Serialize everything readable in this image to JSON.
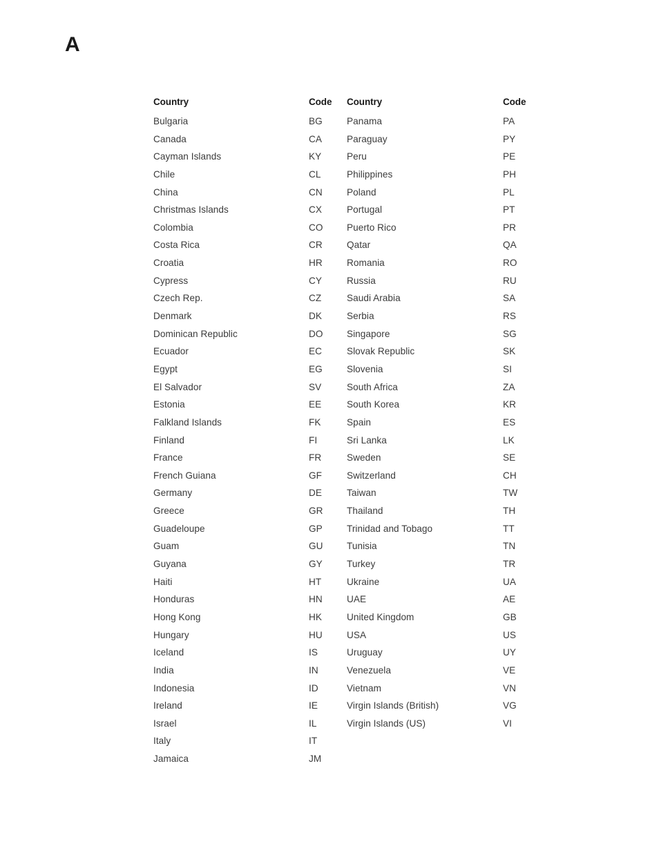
{
  "page": {
    "appendix_letter": "A",
    "background_color": "#ffffff",
    "text_color": "#3b3b3b",
    "heading_color": "#1a1a1a"
  },
  "table": {
    "headers": {
      "country": "Country",
      "code": "Code"
    },
    "left_column": [
      {
        "country": "Bulgaria",
        "code": "BG"
      },
      {
        "country": "Canada",
        "code": "CA"
      },
      {
        "country": "Cayman Islands",
        "code": "KY"
      },
      {
        "country": "Chile",
        "code": "CL"
      },
      {
        "country": "China",
        "code": "CN"
      },
      {
        "country": "Christmas Islands",
        "code": "CX"
      },
      {
        "country": "Colombia",
        "code": "CO"
      },
      {
        "country": "Costa Rica",
        "code": "CR"
      },
      {
        "country": "Croatia",
        "code": "HR"
      },
      {
        "country": "Cypress",
        "code": "CY"
      },
      {
        "country": "Czech Rep.",
        "code": "CZ"
      },
      {
        "country": "Denmark",
        "code": "DK"
      },
      {
        "country": "Dominican Republic",
        "code": "DO"
      },
      {
        "country": "Ecuador",
        "code": "EC"
      },
      {
        "country": "Egypt",
        "code": "EG"
      },
      {
        "country": "El Salvador",
        "code": "SV"
      },
      {
        "country": "Estonia",
        "code": "EE"
      },
      {
        "country": "Falkland Islands",
        "code": "FK"
      },
      {
        "country": "Finland",
        "code": "FI"
      },
      {
        "country": "France",
        "code": "FR"
      },
      {
        "country": "French Guiana",
        "code": "GF"
      },
      {
        "country": "Germany",
        "code": "DE"
      },
      {
        "country": "Greece",
        "code": "GR"
      },
      {
        "country": "Guadeloupe",
        "code": "GP"
      },
      {
        "country": "Guam",
        "code": "GU"
      },
      {
        "country": "Guyana",
        "code": "GY"
      },
      {
        "country": "Haiti",
        "code": "HT"
      },
      {
        "country": "Honduras",
        "code": "HN"
      },
      {
        "country": "Hong Kong",
        "code": "HK"
      },
      {
        "country": "Hungary",
        "code": "HU"
      },
      {
        "country": "Iceland",
        "code": "IS"
      },
      {
        "country": "India",
        "code": "IN"
      },
      {
        "country": "Indonesia",
        "code": "ID"
      },
      {
        "country": "Ireland",
        "code": "IE"
      },
      {
        "country": "Israel",
        "code": "IL"
      },
      {
        "country": "Italy",
        "code": "IT"
      },
      {
        "country": "Jamaica",
        "code": "JM"
      }
    ],
    "right_column": [
      {
        "country": "Panama",
        "code": "PA"
      },
      {
        "country": "Paraguay",
        "code": "PY"
      },
      {
        "country": "Peru",
        "code": "PE"
      },
      {
        "country": "Philippines",
        "code": "PH"
      },
      {
        "country": "Poland",
        "code": "PL"
      },
      {
        "country": "Portugal",
        "code": "PT"
      },
      {
        "country": "Puerto Rico",
        "code": "PR"
      },
      {
        "country": "Qatar",
        "code": "QA"
      },
      {
        "country": "Romania",
        "code": "RO"
      },
      {
        "country": "Russia",
        "code": "RU"
      },
      {
        "country": "Saudi Arabia",
        "code": "SA"
      },
      {
        "country": "Serbia",
        "code": "RS"
      },
      {
        "country": "Singapore",
        "code": "SG"
      },
      {
        "country": "Slovak Republic",
        "code": "SK"
      },
      {
        "country": "Slovenia",
        "code": "SI"
      },
      {
        "country": "South Africa",
        "code": "ZA"
      },
      {
        "country": "South Korea",
        "code": "KR"
      },
      {
        "country": "Spain",
        "code": "ES"
      },
      {
        "country": "Sri Lanka",
        "code": "LK"
      },
      {
        "country": "Sweden",
        "code": "SE"
      },
      {
        "country": "Switzerland",
        "code": "CH"
      },
      {
        "country": "Taiwan",
        "code": "TW"
      },
      {
        "country": "Thailand",
        "code": "TH"
      },
      {
        "country": "Trinidad and Tobago",
        "code": "TT"
      },
      {
        "country": "Tunisia",
        "code": "TN"
      },
      {
        "country": "Turkey",
        "code": "TR"
      },
      {
        "country": "Ukraine",
        "code": "UA"
      },
      {
        "country": "UAE",
        "code": "AE"
      },
      {
        "country": "United Kingdom",
        "code": "GB"
      },
      {
        "country": "USA",
        "code": "US"
      },
      {
        "country": "Uruguay",
        "code": "UY"
      },
      {
        "country": "Venezuela",
        "code": "VE"
      },
      {
        "country": "Vietnam",
        "code": "VN"
      },
      {
        "country": "Virgin Islands (British)",
        "code": "VG"
      },
      {
        "country": "Virgin Islands (US)",
        "code": "VI"
      }
    ]
  }
}
